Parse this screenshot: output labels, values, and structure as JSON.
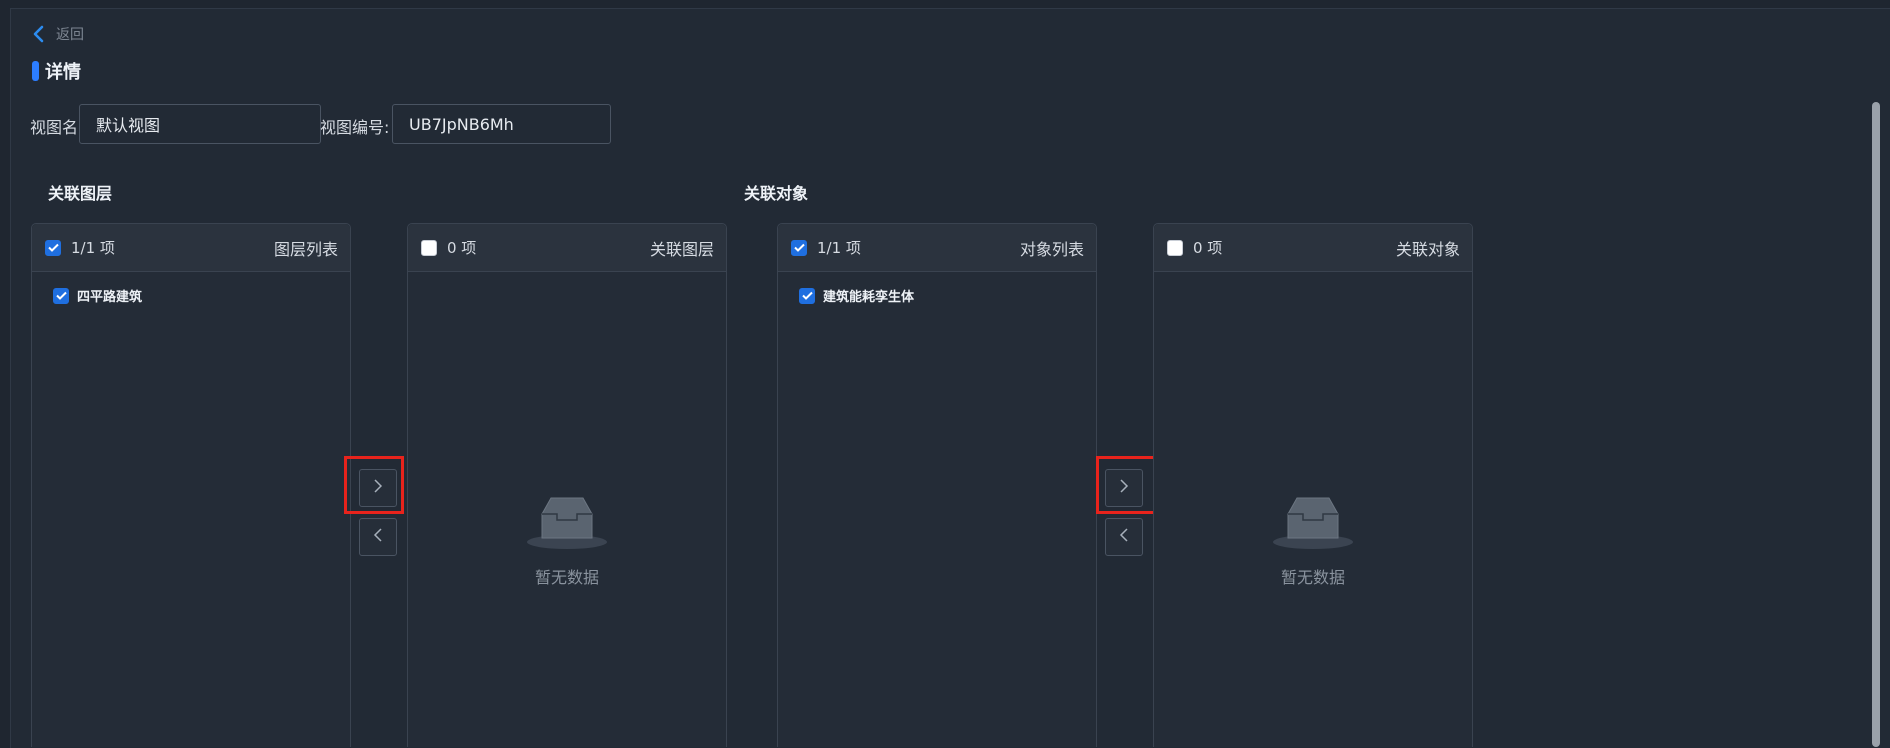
{
  "back": {
    "label": "返回"
  },
  "page_title": "详情",
  "fields": {
    "view_name": {
      "label": "视图名",
      "value": "默认视图"
    },
    "view_code": {
      "label": "视图编号:",
      "value": "UB7JpNB6Mh"
    }
  },
  "sections": {
    "layers": "关联图层",
    "objects": "关联对象"
  },
  "layer_transfer": {
    "source": {
      "count": "1/1 项",
      "title": "图层列表",
      "items": [
        {
          "label": "四平路建筑",
          "checked": true
        }
      ]
    },
    "target": {
      "count": "0 项",
      "title": "关联图层",
      "empty": "暂无数据"
    }
  },
  "object_transfer": {
    "source": {
      "count": "1/1 项",
      "title": "对象列表",
      "items": [
        {
          "label": "建筑能耗孪生体",
          "checked": true
        }
      ]
    },
    "target": {
      "count": "0 项",
      "title": "关联对象",
      "empty": "暂无数据"
    }
  },
  "colors": {
    "accent": "#1f6fe0",
    "highlight": "#e8231c",
    "background": "#222a35"
  }
}
